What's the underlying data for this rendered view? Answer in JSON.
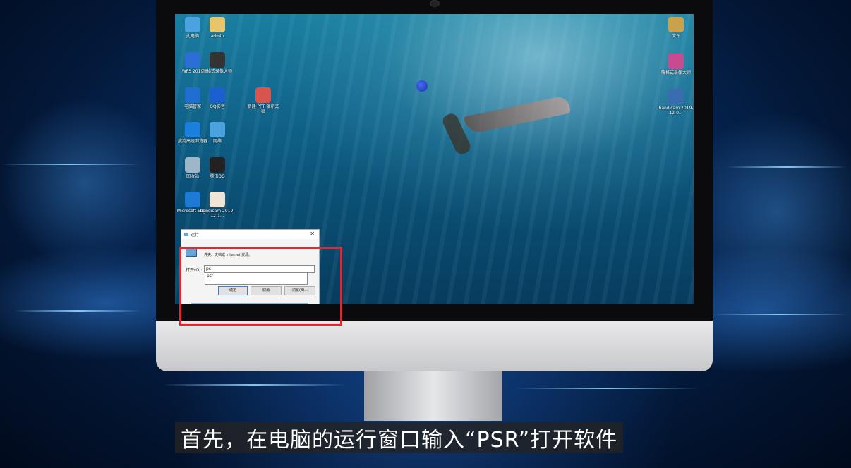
{
  "desktop_icons": [
    {
      "label": "此电脑",
      "icon": "computer-icon",
      "color": "#4aa3df"
    },
    {
      "label": "admin",
      "icon": "user-folder-icon",
      "color": "#e8c46a"
    },
    {
      "label": "WPS 2019",
      "icon": "wps-icon",
      "color": "#2b6fd6"
    },
    {
      "label": "嗨格式录像大师",
      "icon": "recorder-icon",
      "color": "#333333"
    },
    {
      "label": "电脑管家",
      "icon": "shield-icon",
      "color": "#1f6fd1"
    },
    {
      "label": "QQ影音",
      "icon": "qq-player-icon",
      "color": "#1c5fcf"
    },
    {
      "label": "搜狗高速浏览器",
      "icon": "sogou-browser-icon",
      "color": "#1b7fe0"
    },
    {
      "label": "网络",
      "icon": "network-icon",
      "color": "#4aa3df"
    },
    {
      "label": "回收站",
      "icon": "recycle-bin-icon",
      "color": "#9db6c8"
    },
    {
      "label": "腾讯QQ",
      "icon": "qq-penguin-icon",
      "color": "#222222"
    },
    {
      "label": "Microsoft Edge",
      "icon": "edge-icon",
      "color": "#1f7ad6"
    },
    {
      "label": "bandicam 2019-12-1...",
      "icon": "file-icon",
      "color": "#f0e6d8"
    },
    {
      "label": "新建 PPT 演示文稿",
      "icon": "ppt-file-icon",
      "color": "#d9534f"
    }
  ],
  "right_icons": [
    {
      "label": "文件",
      "icon": "archive-icon",
      "color": "#c9a24a"
    },
    {
      "label": "嗨格式录像大师",
      "icon": "video-file-icon",
      "color": "#c84b8f"
    },
    {
      "label": "bandicam 2019-12-0...",
      "icon": "camera-icon",
      "color": "#3a6db0"
    }
  ],
  "run_dialog": {
    "title": "运行",
    "description": "件夹、文档或 Internet 资源。",
    "open_label": "打开(O):",
    "input_value": "ps",
    "autocomplete": "psr",
    "ok": "确定",
    "cancel": "取消",
    "browse": "浏览(B)..."
  },
  "subtitle": "首先，在电脑的运行窗口输入“PSR”打开软件",
  "colors": {
    "highlight": "#e6262e"
  }
}
